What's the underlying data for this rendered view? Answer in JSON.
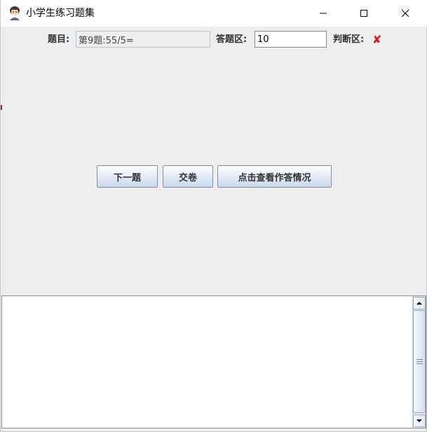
{
  "window": {
    "title": "小学生练习题集",
    "icon": "student-avatar-icon",
    "controls": [
      "minimize-icon",
      "maximize-icon",
      "close-icon"
    ]
  },
  "form": {
    "question_label": "题目:",
    "question_value": "第9题:55/5=",
    "answer_label": "答题区:",
    "answer_value": "10",
    "judge_label": "判断区:",
    "judge_mark": "✘"
  },
  "buttons": {
    "next": "下一题",
    "submit": "交卷",
    "view": "点击查看作答情况"
  },
  "output": {
    "text": ""
  },
  "colors": {
    "wrong_mark": "#e0101a",
    "panel_background": "#eeeeee"
  }
}
